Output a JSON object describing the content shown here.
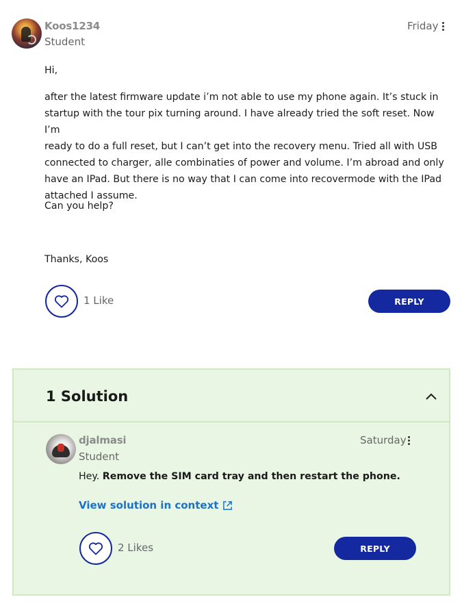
{
  "post": {
    "username": "Koos1234",
    "rank": "Student",
    "date": "Friday",
    "greeting": "Hi,",
    "paragraph1_lines": [
      "after the latest firmware update i’m not able to use my phone again. It’s stuck in",
      "startup with the tour pix turning around. I have already tried the soft reset. Now I’m",
      "ready to do a full reset, but I can’t get into the recovery menu. Tried all with USB",
      "connected to charger, alle combinaties of power and volume. I’m abroad and only",
      "have an IPad. But there is no way that I can come into recovermode with the IPad",
      "attached I assume."
    ],
    "question": "Can you help?",
    "signoff": "Thanks, Koos",
    "likes": "1 Like",
    "reply_label": "REPLY"
  },
  "solution": {
    "title": "1 Solution",
    "username": "djalmasi",
    "rank": "Student",
    "date": "Saturday",
    "text_plain": "Hey. ",
    "text_bold": "Remove the SIM card tray and then restart the phone.",
    "view_link": "View solution in context",
    "likes": "2 Likes",
    "reply_label": "REPLY"
  },
  "colors": {
    "accent": "#1428a0",
    "link": "#1a73c8",
    "solution_bg": "#eaf6e4",
    "solution_border": "#cfeac2"
  },
  "icons": [
    "heart-icon",
    "kebab-menu-icon",
    "chevron-up-icon",
    "external-link-icon"
  ]
}
